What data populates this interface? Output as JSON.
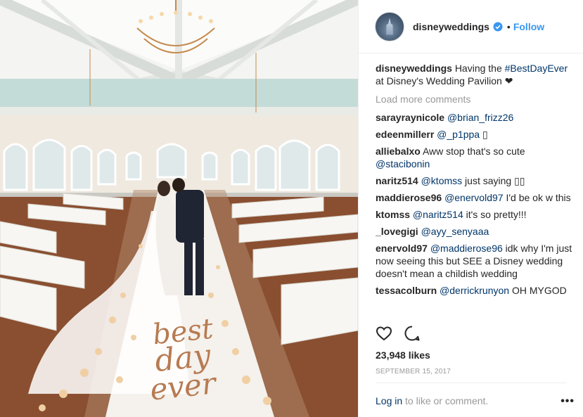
{
  "post": {
    "photo": {
      "text_lines": [
        "best",
        "day",
        "ever"
      ]
    },
    "header": {
      "username": "disneyweddings",
      "separator": "•",
      "follow_label": "Follow"
    },
    "caption": {
      "user": "disneyweddings",
      "text_before": "Having the ",
      "hashtag": "#BestDayEver",
      "text_after": " at Disney's Wedding Pavilion ❤"
    },
    "load_more": "Load more comments",
    "comments": [
      {
        "user": "sarayraynicole",
        "mention": "@brian_frizz26",
        "text": ""
      },
      {
        "user": "edeenmillerr",
        "mention": "@_p1ppa",
        "text": " ▯"
      },
      {
        "user": "alliebalxo",
        "mention": "",
        "text": "Aww stop that's so cute",
        "mention_after": "@stacibonin"
      },
      {
        "user": "naritz514",
        "mention": "@ktomss",
        "text": " just saying ▯▯"
      },
      {
        "user": "maddierose96",
        "mention": "@enervold97",
        "text": " I'd be ok w this"
      },
      {
        "user": "ktomss",
        "mention": "@naritz514",
        "text": " it's so pretty!!!"
      },
      {
        "user": "_lovegigi",
        "mention": "@ayy_senyaaa",
        "text": ""
      },
      {
        "user": "enervold97",
        "mention": "@maddierose96",
        "text": " idk why I'm just now seeing this but SEE a Disney wedding doesn't mean a childish wedding"
      },
      {
        "user": "tessacolburn",
        "mention": "@derrickrunyon",
        "text": " OH MYGOD"
      }
    ],
    "likes": "23,948 likes",
    "date": "SEPTEMBER 15, 2017",
    "login": {
      "link": "Log in",
      "text": " to like or comment."
    },
    "more_label": "•••"
  },
  "colors": {
    "link": "#003569",
    "follow": "#3897f0",
    "muted": "#999999"
  },
  "icons": [
    "heart-icon",
    "comment-icon",
    "verified-badge-icon",
    "more-options-icon"
  ]
}
